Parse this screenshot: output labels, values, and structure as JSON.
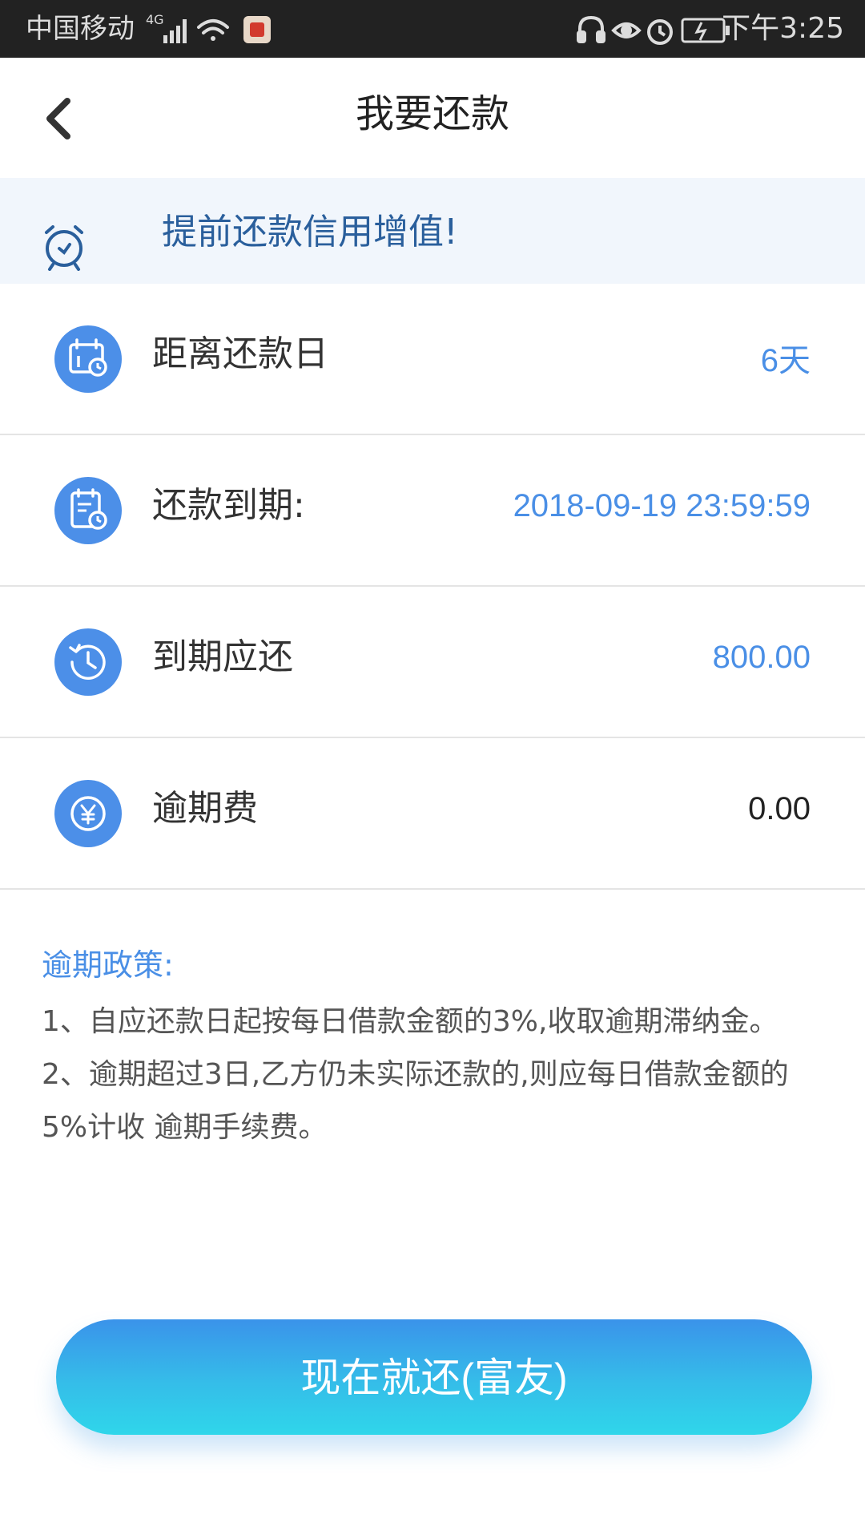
{
  "status_bar": {
    "carrier": "中国移动",
    "network": "4G",
    "time": "下午3:25"
  },
  "header": {
    "title": "我要还款"
  },
  "tip": {
    "text": "提前还款信用增值!"
  },
  "rows": [
    {
      "icon": "calendar-icon",
      "label": "距离还款日",
      "value": "6天"
    },
    {
      "icon": "due-date-icon",
      "label": "还款到期:",
      "value": "2018-09-19 23:59:59"
    },
    {
      "icon": "history-clock-icon",
      "label": "到期应还",
      "value": "800.00"
    },
    {
      "icon": "yen-icon",
      "label": "逾期费",
      "value": "0.00"
    }
  ],
  "policy": {
    "title": "逾期政策:",
    "items": [
      "1、自应还款日起按每日借款金额的3%,收取逾期滞纳金。",
      "2、逾期超过3日,乙方仍未实际还款的,则应每日借款金额的5%计收 逾期手续费。"
    ]
  },
  "pay_button": {
    "label": "现在就还(富友)"
  },
  "colors": {
    "accent": "#4a8fe6",
    "icon_bg": "#4c8fe8",
    "banner_bg": "#f1f6fc",
    "banner_text": "#2a5f9c",
    "status_bar_bg": "#222222"
  }
}
